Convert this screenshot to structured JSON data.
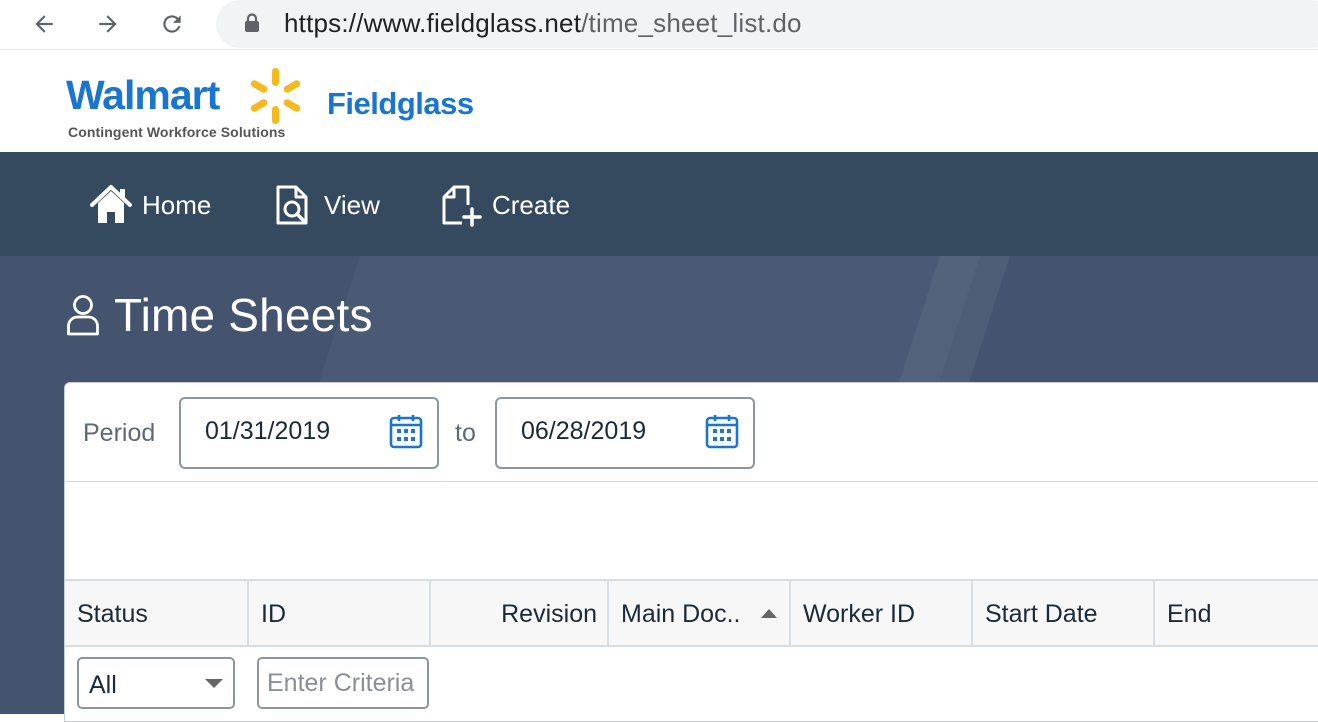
{
  "browser": {
    "url_host": "https://www.fieldglass.net",
    "url_path": "/time_sheet_list.do"
  },
  "brand": {
    "logo_word": "Walmart",
    "tagline": "Contingent Workforce Solutions",
    "product": "Fieldglass",
    "primary_color": "#1a75cf",
    "spark_color": "#f5b81d"
  },
  "nav": {
    "items": [
      {
        "label": "Home",
        "icon": "home-icon"
      },
      {
        "label": "View",
        "icon": "view-document-icon"
      },
      {
        "label": "Create",
        "icon": "create-document-icon"
      }
    ],
    "bg_color": "#354a5f"
  },
  "page": {
    "title": "Time Sheets",
    "icon": "person-icon"
  },
  "period": {
    "label": "Period",
    "start": "01/31/2019",
    "to_label": "to",
    "end": "06/28/2019"
  },
  "table": {
    "columns": [
      {
        "label": "Status"
      },
      {
        "label": "ID"
      },
      {
        "label": "Revision"
      },
      {
        "label": "Main Doc.."
      },
      {
        "label": "Worker ID"
      },
      {
        "label": "Start Date"
      },
      {
        "label": "End"
      }
    ],
    "filters": {
      "status_value": "All",
      "id_placeholder": "Enter Criteria"
    }
  }
}
